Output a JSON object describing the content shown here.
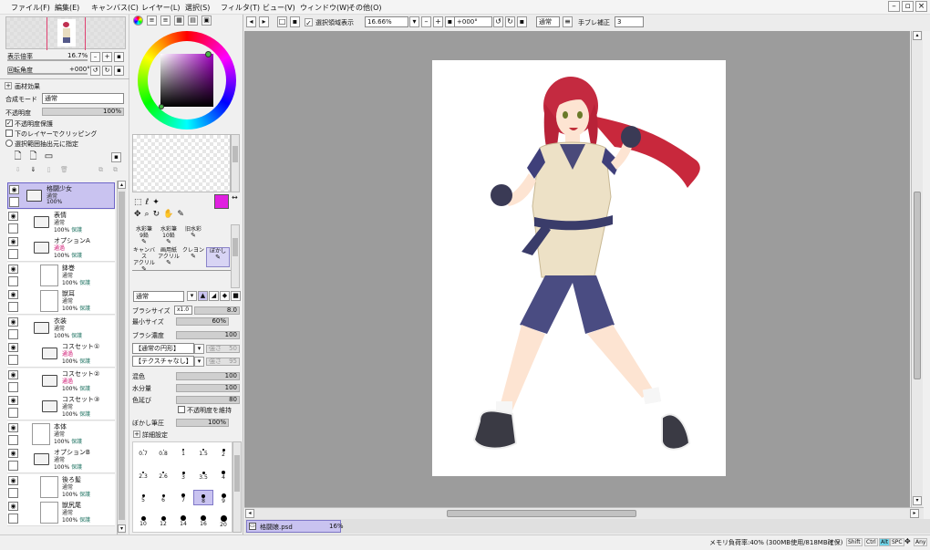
{
  "menu": {
    "items": [
      "ファイル(F)",
      "編集(E)",
      "キャンバス(C)",
      "レイヤー(L)",
      "選択(S)",
      "フィルタ(T)",
      "ビュー(V)",
      "ウィンドウ(W)",
      "その他(O)"
    ]
  },
  "toolbar": {
    "selection_visible_label": "選択領域表示",
    "zoom": "16.66%",
    "rotation": "+000°",
    "mode": "通常",
    "stabilizer_label": "手ブレ補正",
    "stabilizer_value": "3"
  },
  "navigator": {
    "zoom_label": "表示倍率",
    "zoom_value": "16.7%",
    "rotation_label": "回転角度",
    "rotation_value": "+000°"
  },
  "layer_props": {
    "paper_effect": "画材効果",
    "blend_label": "合成モード",
    "blend_value": "通常",
    "opacity_label": "不透明度",
    "opacity_value": "100%",
    "lock_opacity": "不透明度保護",
    "clip": "下のレイヤーでクリッピング",
    "selection_source": "選択範囲抽出元に指定"
  },
  "layers": [
    {
      "name": "格闘少女",
      "mode": "通常",
      "opacity": "100%",
      "protect": "",
      "type": "folder",
      "indent": 0,
      "selected": true
    },
    {
      "name": "表情",
      "mode": "通常",
      "opacity": "100%",
      "protect": "保護",
      "type": "folder",
      "indent": 1
    },
    {
      "name": "オプションA",
      "mode": "通過",
      "opacity": "100%",
      "protect": "保護",
      "type": "folder",
      "indent": 1,
      "pink": true
    },
    {
      "name": "鉢巻",
      "mode": "通常",
      "opacity": "100%",
      "protect": "保護",
      "type": "thumb",
      "indent": 2
    },
    {
      "name": "獣耳",
      "mode": "通常",
      "opacity": "100%",
      "protect": "保護",
      "type": "thumb",
      "indent": 2
    },
    {
      "name": "衣装",
      "mode": "通常",
      "opacity": "100%",
      "protect": "保護",
      "type": "folder",
      "indent": 1
    },
    {
      "name": "コスセット①",
      "mode": "通過",
      "opacity": "100%",
      "protect": "保護",
      "type": "folder",
      "indent": 2,
      "pink": true
    },
    {
      "name": "コスセット②",
      "mode": "通過",
      "opacity": "100%",
      "protect": "保護",
      "type": "folder",
      "indent": 2,
      "pink": true
    },
    {
      "name": "コスセット③",
      "mode": "通常",
      "opacity": "100%",
      "protect": "保護",
      "type": "folder",
      "indent": 2
    },
    {
      "name": "本体",
      "mode": "通常",
      "opacity": "100%",
      "protect": "保護",
      "type": "thumb",
      "indent": 1
    },
    {
      "name": "オプションB",
      "mode": "通常",
      "opacity": "100%",
      "protect": "保護",
      "type": "folder",
      "indent": 1
    },
    {
      "name": "後ろ髪",
      "mode": "通常",
      "opacity": "100%",
      "protect": "保護",
      "type": "thumb",
      "indent": 2
    },
    {
      "name": "獣尻尾",
      "mode": "通常",
      "opacity": "100%",
      "protect": "保護",
      "type": "thumb",
      "indent": 2
    }
  ],
  "tools": [
    {
      "label": "水彩筆",
      "sub": "9鉛"
    },
    {
      "label": "水彩筆",
      "sub": "10鉛"
    },
    {
      "label": "旧水彩",
      "sub": ""
    },
    {
      "label": "",
      "sub": ""
    },
    {
      "label": "キャンバス",
      "sub": "アクリル"
    },
    {
      "label": "画用紙",
      "sub": "アクリル"
    },
    {
      "label": "クレヨン",
      "sub": ""
    },
    {
      "label": "ぼかし",
      "sub": ""
    }
  ],
  "brush": {
    "mode": "通常",
    "size_label": "ブラシサイズ",
    "size_mult": "x1.0",
    "size_value": "8.0",
    "min_size_label": "最小サイズ",
    "min_size_value": "60%",
    "density_label": "ブラシ濃度",
    "density_value": "100",
    "shape": "【通常の円形】",
    "shape_strength": "強さ",
    "shape_value": "50",
    "texture": "【テクスチャなし】",
    "tex_strength": "強さ",
    "tex_value": "95",
    "mix_label": "混色",
    "mix_value": "100",
    "water_label": "水分量",
    "water_value": "100",
    "persist_label": "色延び",
    "persist_value": "80",
    "keep_opacity": "不透明度を維持",
    "blur_label": "ぼかし筆圧",
    "blur_value": "100%",
    "advanced": "詳細設定"
  },
  "brush_sizes": [
    "0.7",
    "0.8",
    "1",
    "1.5",
    "2",
    "2.3",
    "2.6",
    "3",
    "3.5",
    "4",
    "5",
    "6",
    "7",
    "8",
    "9",
    "10",
    "12",
    "14",
    "16",
    "20"
  ],
  "doc_tab": {
    "name": "格闘娘.psd",
    "zoom": "16%"
  },
  "status": {
    "memory": "メモリ負荷率:40% (300MB使用/818MB確保)",
    "keys": [
      "Shift",
      "Ctrl",
      "Alt",
      "SPC",
      "Any"
    ]
  },
  "colors": {
    "accent": "#c9c3f0",
    "current_color": "#e020e0",
    "canvas_bg": "#9c9c9c"
  }
}
